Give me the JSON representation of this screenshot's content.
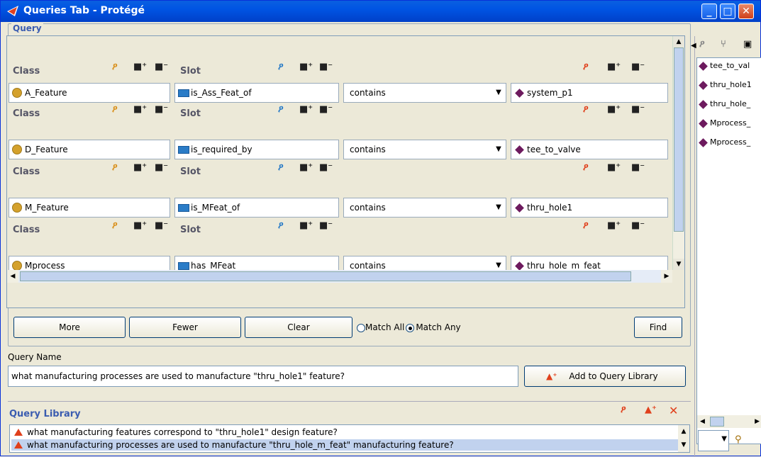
{
  "window": {
    "title": "Queries Tab - Protégé"
  },
  "query_panel": {
    "title": "Query"
  },
  "rows": [
    {
      "class_label": "Class",
      "slot_label": "Slot",
      "class_value": "A_Feature",
      "slot_value": "is_Ass_Feat_of",
      "operator": "contains",
      "value": "system_p1"
    },
    {
      "class_label": "Class",
      "slot_label": "Slot",
      "class_value": "D_Feature",
      "slot_value": "is_required_by",
      "operator": "contains",
      "value": "tee_to_valve"
    },
    {
      "class_label": "Class",
      "slot_label": "Slot",
      "class_value": "M_Feature",
      "slot_value": "is_MFeat_of",
      "operator": "contains",
      "value": "thru_hole1"
    },
    {
      "class_label": "Class",
      "slot_label": "Slot",
      "class_value": "Mprocess",
      "slot_value": "has_MFeat",
      "operator": "contains",
      "value": "thru_hole_m_feat"
    }
  ],
  "buttons": {
    "more": "More",
    "fewer": "Fewer",
    "clear": "Clear",
    "match_all": "Match All",
    "match_any": "Match Any",
    "find": "Find",
    "add_library": "Add to Query Library"
  },
  "match_mode": "Match Any",
  "query_name": {
    "label": "Query Name",
    "value": "what manufacturing processes are used to manufacture \"thru_hole1\" feature?"
  },
  "library": {
    "title": "Query Library",
    "items": [
      "what manufacturing features correspond to \"thru_hole1\" design feature?",
      "what manufacturing processes are used to manufacture \"thru_hole_m_feat\" manufacturing feature?"
    ]
  },
  "right_list": {
    "items": [
      "tee_to_val",
      "thru_hole1",
      "thru_hole_",
      "Mprocess_",
      "Mprocess_"
    ]
  },
  "colors": {
    "title_bar": "#0054e3",
    "accent_blue": "#3a5cb0",
    "class_icon": "#d4a12c",
    "instance_icon": "#6d1a5e",
    "selected_row": "#c1d2ee"
  }
}
